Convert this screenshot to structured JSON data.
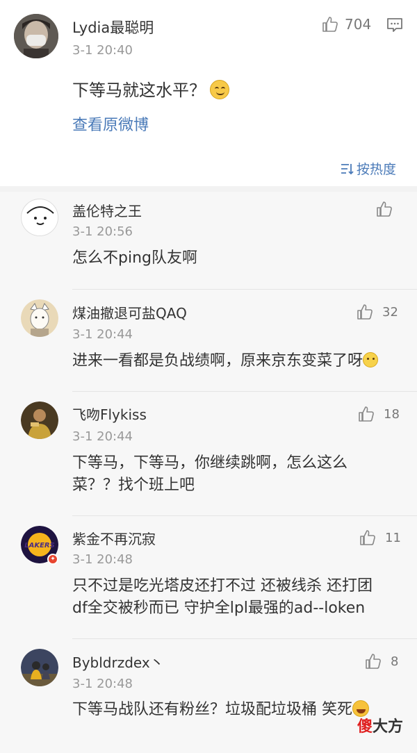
{
  "post": {
    "author": "Lydia最聪明",
    "time": "3-1 20:40",
    "text": "下等马就这水平？",
    "emoji": "smug-face-emoji",
    "view_original": "查看原微博",
    "like_count": "704",
    "sort_label": "按热度"
  },
  "comments": [
    {
      "name": "盖伦特之王",
      "time": "3-1 20:56",
      "text": "怎么不ping队友啊",
      "likes": ""
    },
    {
      "name": "煤油撤退可盐QAQ",
      "time": "3-1 20:44",
      "text": "进来一看都是负战绩啊，原来京东变菜了呀",
      "likes": "32"
    },
    {
      "name": "飞吻Flykiss",
      "time": "3-1 20:44",
      "text_line1": "下等马，下等马，你继续跳啊，怎么这么",
      "text_line2": "菜？？找个班上吧",
      "likes": "18"
    },
    {
      "name": "紫金不再沉寂",
      "time": "3-1 20:48",
      "text_line1": "只不过是吃光塔皮还打不过 还被线杀 还打团",
      "text_line2": "df全交被秒而已 守护全lpl最强的ad--loken",
      "likes": "11"
    },
    {
      "name": "Bybldrzdex丶",
      "time": "3-1 20:48",
      "text": "下等马战队还有粉丝？垃圾配垃圾桶  笑死",
      "likes": "8"
    }
  ],
  "watermark": {
    "red": "傻",
    "black": "大方"
  },
  "colors": {
    "link": "#4a7ab8",
    "muted": "#999999",
    "comments_bg": "#f7f7f7"
  }
}
